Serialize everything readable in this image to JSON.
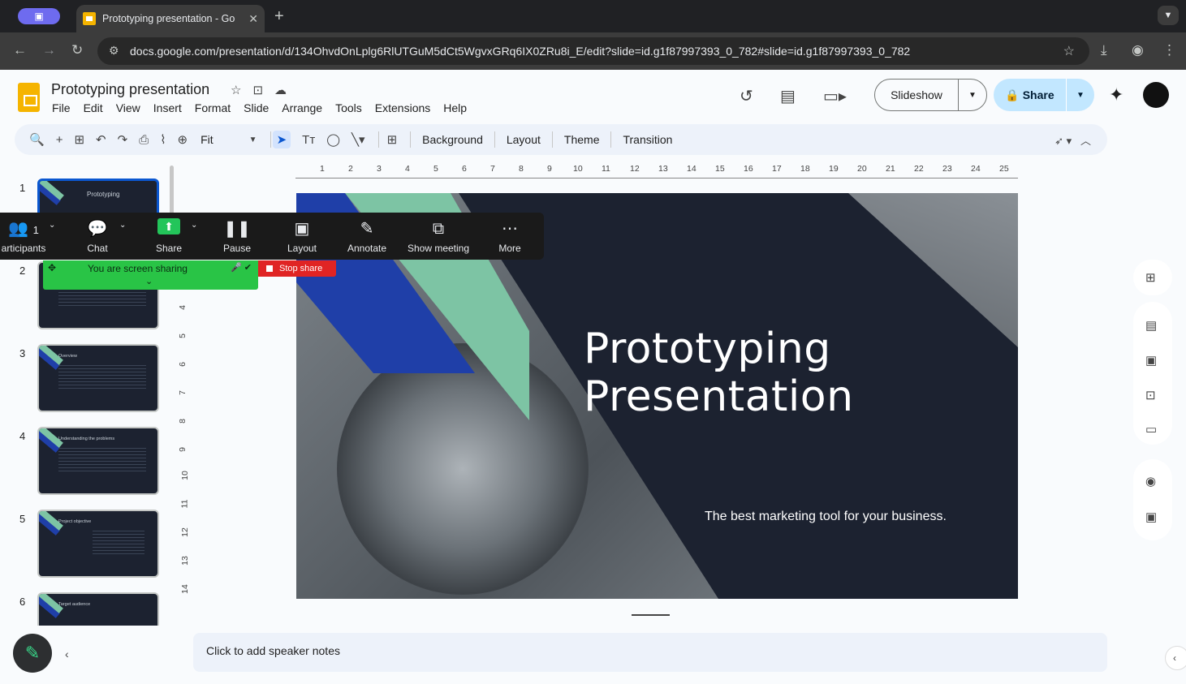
{
  "browser": {
    "tab_title": "Prototyping presentation - Go",
    "tab_close": "✕",
    "new_tab": "+",
    "url": "docs.google.com/presentation/d/134OhvdOnLplg6RlUTGuM5dCt5WgvxGRq6IX0ZRu8i_E/edit?slide=id.g1f87997393_0_782#slide=id.g1f87997393_0_782"
  },
  "app": {
    "doc_title": "Prototyping presentation",
    "menu": [
      "File",
      "Edit",
      "View",
      "Insert",
      "Format",
      "Slide",
      "Arrange",
      "Tools",
      "Extensions",
      "Help"
    ],
    "slideshow_label": "Slideshow",
    "share_label": "Share",
    "toolbar": {
      "zoom_label": "Fit",
      "background": "Background",
      "layout": "Layout",
      "theme": "Theme",
      "transition": "Transition"
    }
  },
  "slides": [
    {
      "num": "1",
      "title": "Prototyping"
    },
    {
      "num": "2",
      "title": "Overview"
    },
    {
      "num": "3",
      "title": "Overview"
    },
    {
      "num": "4",
      "title": "Understanding the problems"
    },
    {
      "num": "5",
      "title": "Project objective"
    },
    {
      "num": "6",
      "title": "Target audience"
    }
  ],
  "ruler": {
    "h_ticks": [
      "1",
      "2",
      "3",
      "4",
      "5",
      "6",
      "7",
      "8",
      "9",
      "10",
      "11",
      "12",
      "13",
      "14",
      "15",
      "16",
      "17",
      "18",
      "19",
      "20",
      "21",
      "22",
      "23",
      "24",
      "25"
    ],
    "v_ticks": [
      "4",
      "5",
      "6",
      "7",
      "8",
      "9",
      "10",
      "11",
      "12",
      "13",
      "14"
    ]
  },
  "current_slide": {
    "title": "Prototyping\nPresentation",
    "subtitle": "The best marketing tool for your business."
  },
  "notes_placeholder": "Click to add speaker notes",
  "zoom_share": {
    "participants_count": "1",
    "participants_label": "articipants",
    "chat": "Chat",
    "share": "Share",
    "pause": "Pause",
    "layout": "Layout",
    "annotate": "Annotate",
    "show_meeting": "Show meeting",
    "more": "More",
    "banner": "You are screen sharing",
    "stop_share": "Stop share"
  },
  "colors": {
    "accent_blue": "#0b57d0",
    "slide_bg": "#1c2230",
    "slide_green": "#7dc4a4",
    "slide_blue": "#1f3fa8",
    "zoom_green": "#29c446",
    "stop_red": "#e02424"
  }
}
